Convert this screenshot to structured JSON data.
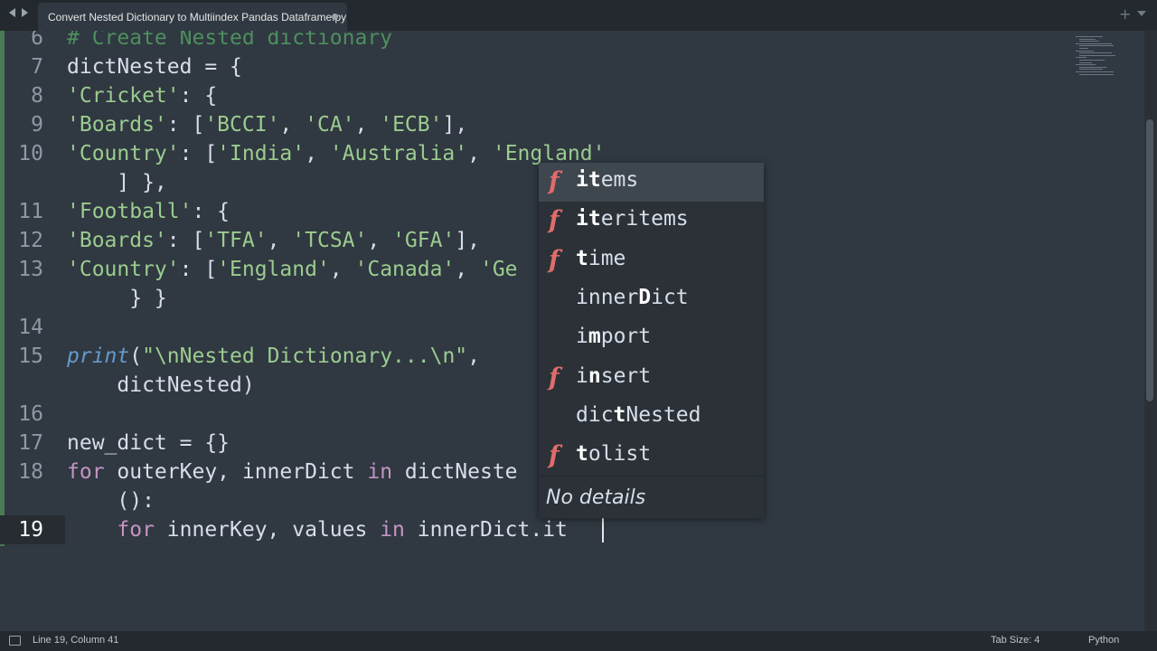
{
  "window": {
    "tab_title": "Convert Nested Dictionary to Multiindex Pandas Dataframe.py",
    "new_tab_label": "+"
  },
  "editor": {
    "lines": [
      {
        "num": "6",
        "segments": [
          {
            "t": "# Create Nested dictionary",
            "c": "cmt"
          }
        ]
      },
      {
        "num": "7",
        "segments": [
          {
            "t": "dictNested = {",
            "c": "op"
          }
        ]
      },
      {
        "num": "8",
        "segments": [
          {
            "t": "'Cricket'",
            "c": "str"
          },
          {
            "t": ": {",
            "c": "op"
          }
        ]
      },
      {
        "num": "9",
        "segments": [
          {
            "t": "'Boards'",
            "c": "str"
          },
          {
            "t": ": [",
            "c": "op"
          },
          {
            "t": "'BCCI'",
            "c": "str"
          },
          {
            "t": ", ",
            "c": "op"
          },
          {
            "t": "'CA'",
            "c": "str"
          },
          {
            "t": ", ",
            "c": "op"
          },
          {
            "t": "'ECB'",
            "c": "str"
          },
          {
            "t": "],",
            "c": "op"
          }
        ]
      },
      {
        "num": "10",
        "segments": [
          {
            "t": "'Country'",
            "c": "str"
          },
          {
            "t": ": [",
            "c": "op"
          },
          {
            "t": "'India'",
            "c": "str"
          },
          {
            "t": ", ",
            "c": "op"
          },
          {
            "t": "'Australia'",
            "c": "str"
          },
          {
            "t": ", ",
            "c": "op"
          },
          {
            "t": "'England'",
            "c": "str"
          }
        ]
      },
      {
        "num": "",
        "segments": [
          {
            "t": "    ] },",
            "c": "op"
          }
        ]
      },
      {
        "num": "11",
        "segments": [
          {
            "t": "'Football'",
            "c": "str"
          },
          {
            "t": ": {",
            "c": "op"
          }
        ]
      },
      {
        "num": "12",
        "segments": [
          {
            "t": "'Boards'",
            "c": "str"
          },
          {
            "t": ": [",
            "c": "op"
          },
          {
            "t": "'TFA'",
            "c": "str"
          },
          {
            "t": ", ",
            "c": "op"
          },
          {
            "t": "'TCSA'",
            "c": "str"
          },
          {
            "t": ", ",
            "c": "op"
          },
          {
            "t": "'GFA'",
            "c": "str"
          },
          {
            "t": "],",
            "c": "op"
          }
        ]
      },
      {
        "num": "13",
        "segments": [
          {
            "t": "'Country'",
            "c": "str"
          },
          {
            "t": ": [",
            "c": "op"
          },
          {
            "t": "'England'",
            "c": "str"
          },
          {
            "t": ", ",
            "c": "op"
          },
          {
            "t": "'Canada'",
            "c": "str"
          },
          {
            "t": ", ",
            "c": "op"
          },
          {
            "t": "'Ge",
            "c": "str"
          }
        ]
      },
      {
        "num": "",
        "segments": [
          {
            "t": "     } }",
            "c": "op"
          }
        ]
      },
      {
        "num": "14",
        "segments": []
      },
      {
        "num": "15",
        "segments": [
          {
            "t": "print",
            "c": "fn"
          },
          {
            "t": "(",
            "c": "op"
          },
          {
            "t": "\"\\nNested Dictionary...\\n\"",
            "c": "str"
          },
          {
            "t": ",",
            "c": "op"
          }
        ]
      },
      {
        "num": "",
        "segments": [
          {
            "t": "    dictNested)",
            "c": "op"
          }
        ]
      },
      {
        "num": "16",
        "segments": []
      },
      {
        "num": "17",
        "segments": [
          {
            "t": "new_dict = {}",
            "c": "op"
          }
        ]
      },
      {
        "num": "18",
        "segments": [
          {
            "t": "for",
            "c": "kw"
          },
          {
            "t": " outerKey, innerDict ",
            "c": "op"
          },
          {
            "t": "in",
            "c": "kw"
          },
          {
            "t": " dictNeste",
            "c": "op"
          }
        ]
      },
      {
        "num": "",
        "segments": [
          {
            "t": "    ():",
            "c": "op"
          }
        ]
      },
      {
        "num": "19",
        "active": true,
        "segments": [
          {
            "t": "    ",
            "c": "op"
          },
          {
            "t": "for",
            "c": "kw"
          },
          {
            "t": " innerKey, values ",
            "c": "op"
          },
          {
            "t": "in",
            "c": "kw"
          },
          {
            "t": " innerDict.it",
            "c": "op"
          }
        ]
      }
    ]
  },
  "autocomplete": {
    "items": [
      {
        "kind": "f",
        "match": "it",
        "rest": "ems",
        "selected": true
      },
      {
        "kind": "f",
        "match": "it",
        "rest": "eritems"
      },
      {
        "kind": "f",
        "match": "t",
        "rest": "ime",
        "pre": ""
      },
      {
        "kind": "",
        "pre": "inner",
        "match": "D",
        "rest": "ict"
      },
      {
        "kind": "",
        "pre": "i",
        "match": "m",
        "rest": "port"
      },
      {
        "kind": "f",
        "pre": "i",
        "match": "n",
        "rest": "sert"
      },
      {
        "kind": "",
        "pre": "dic",
        "match": "t",
        "rest": "Nested"
      },
      {
        "kind": "f",
        "pre": "",
        "match": "t",
        "rest": "olist"
      }
    ],
    "details": "No details"
  },
  "status": {
    "position": "Line 19, Column 41",
    "tab_size": "Tab Size: 4",
    "syntax": "Python"
  },
  "colors": {
    "background": "#303841",
    "comment": "#4d8f5e",
    "string": "#9bcc8f",
    "keyword": "#c594c5",
    "function": "#6699cc",
    "completion_kind": "#e06c6c"
  }
}
